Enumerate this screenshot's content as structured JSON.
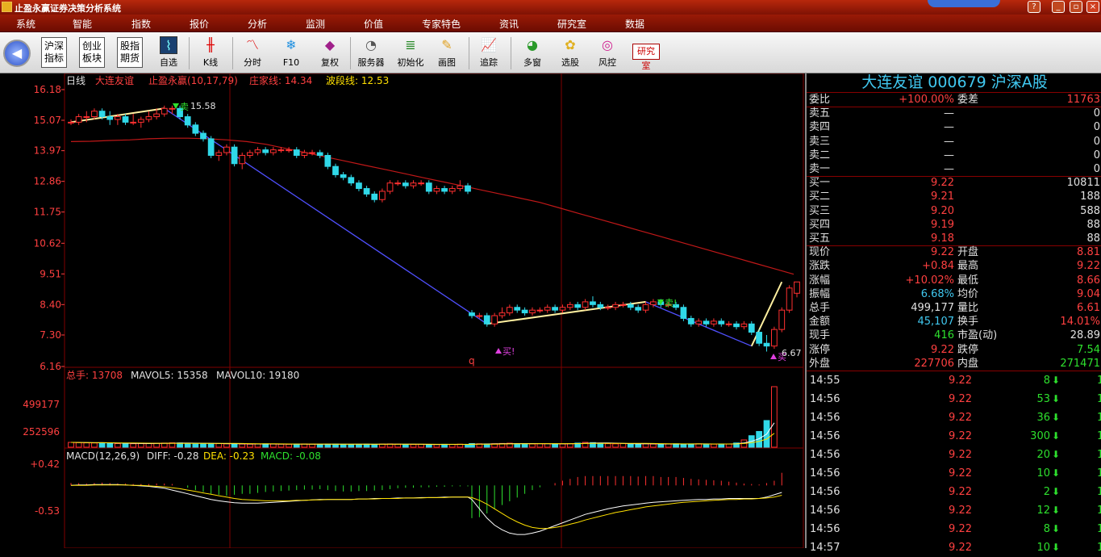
{
  "window": {
    "title": "止盈永赢证券决策分析系统"
  },
  "menu": [
    "系统",
    "智能",
    "指数",
    "报价",
    "分析",
    "监测",
    "价值",
    "专家特色",
    "资讯",
    "研究室",
    "数据"
  ],
  "toolbar": {
    "boxed": [
      "沪深\n指标",
      "创业\n板块",
      "股指\n期货"
    ],
    "buttons": [
      "自选",
      "K线",
      "分时",
      "F10",
      "复权",
      "服务器",
      "初始化",
      "画图",
      "追踪",
      "多窗",
      "选股",
      "风控"
    ],
    "research": "研究室"
  },
  "chart": {
    "period": "日线",
    "stock_name": "大连友谊",
    "indicator": "止盈永赢(10,17,79)",
    "zhuangjia_label": "庄家线: 14.34",
    "boduan_label": "波段线: 12.53",
    "price_ticks": [
      "16.18",
      "15.07",
      "13.97",
      "12.86",
      "11.75",
      "10.62",
      "9.51",
      "8.40",
      "7.30",
      "6.16"
    ],
    "markers": {
      "sell1": "卖",
      "sell1_val": "15.58",
      "buy1": "买!",
      "sell2": "卖!",
      "buy2": "买",
      "buy2_val": "6.67",
      "q": "q"
    },
    "volume": {
      "label": "总手: 13708",
      "ma5": "MAVOL5: 15358",
      "ma10": "MAVOL10: 19180",
      "ticks": [
        "499177",
        "252596"
      ]
    },
    "macd": {
      "label": "MACD(12,26,9)",
      "diff": "DIFF: -0.28",
      "dea": "DEA: -0.23",
      "macd": "MACD: -0.08",
      "ticks": [
        "+0.42",
        "-0.53"
      ]
    }
  },
  "chart_data": {
    "type": "candlestick",
    "price_range": [
      6.16,
      16.18
    ],
    "volume_range": [
      0,
      499177
    ],
    "macd_range": [
      -0.53,
      0.42
    ],
    "candles": [
      [
        15.0,
        15.1,
        14.9,
        15.0
      ],
      [
        15.0,
        15.3,
        14.9,
        15.2
      ],
      [
        15.2,
        15.4,
        15.0,
        15.2
      ],
      [
        15.2,
        15.5,
        15.1,
        15.4
      ],
      [
        15.4,
        15.5,
        15.1,
        15.2
      ],
      [
        15.2,
        15.4,
        14.9,
        15.1
      ],
      [
        15.1,
        15.3,
        14.9,
        15.2
      ],
      [
        15.2,
        15.3,
        14.9,
        15.0
      ],
      [
        15.0,
        15.3,
        14.9,
        15.0
      ],
      [
        15.0,
        15.2,
        14.8,
        15.1
      ],
      [
        15.1,
        15.4,
        15.0,
        15.2
      ],
      [
        15.2,
        15.5,
        15.1,
        15.3
      ],
      [
        15.3,
        15.6,
        15.2,
        15.5
      ],
      [
        15.5,
        15.6,
        15.3,
        15.5
      ],
      [
        15.5,
        15.6,
        15.1,
        15.2
      ],
      [
        15.2,
        15.3,
        14.8,
        14.9
      ],
      [
        14.9,
        15.0,
        14.5,
        14.6
      ],
      [
        14.6,
        14.7,
        14.3,
        14.4
      ],
      [
        14.4,
        14.5,
        13.7,
        13.8
      ],
      [
        13.8,
        14.0,
        13.6,
        13.9
      ],
      [
        13.9,
        14.2,
        13.8,
        14.1
      ],
      [
        14.1,
        14.2,
        13.4,
        13.5
      ],
      [
        13.5,
        13.9,
        13.3,
        13.8
      ],
      [
        13.8,
        14.0,
        13.7,
        13.9
      ],
      [
        13.9,
        14.1,
        13.8,
        14.0
      ],
      [
        14.0,
        14.1,
        13.8,
        13.9
      ],
      [
        13.9,
        14.1,
        13.8,
        14.0
      ],
      [
        14.0,
        14.1,
        13.9,
        14.0
      ],
      [
        14.0,
        14.1,
        13.9,
        14.0
      ],
      [
        14.0,
        14.1,
        13.7,
        13.8
      ],
      [
        13.8,
        14.0,
        13.7,
        13.9
      ],
      [
        13.9,
        14.0,
        13.8,
        13.9
      ],
      [
        13.9,
        14.0,
        13.7,
        13.8
      ],
      [
        13.8,
        13.9,
        13.3,
        13.4
      ],
      [
        13.4,
        13.5,
        13.0,
        13.1
      ],
      [
        13.1,
        13.2,
        12.9,
        13.0
      ],
      [
        13.0,
        13.1,
        12.7,
        12.8
      ],
      [
        12.8,
        12.9,
        12.5,
        12.6
      ],
      [
        12.6,
        12.7,
        12.3,
        12.4
      ],
      [
        12.4,
        12.5,
        12.1,
        12.2
      ],
      [
        12.2,
        12.6,
        12.1,
        12.5
      ],
      [
        12.5,
        12.9,
        12.4,
        12.8
      ],
      [
        12.8,
        12.9,
        12.7,
        12.8
      ],
      [
        12.8,
        12.9,
        12.6,
        12.7
      ],
      [
        12.7,
        12.9,
        12.6,
        12.8
      ],
      [
        12.8,
        12.9,
        12.7,
        12.8
      ],
      [
        12.8,
        12.9,
        12.4,
        12.5
      ],
      [
        12.5,
        12.7,
        12.4,
        12.6
      ],
      [
        12.6,
        12.7,
        12.4,
        12.5
      ],
      [
        12.5,
        12.7,
        12.4,
        12.6
      ],
      [
        12.6,
        12.9,
        12.5,
        12.7
      ],
      [
        12.7,
        12.8,
        12.4,
        12.5
      ],
      [
        8.1,
        8.2,
        7.9,
        8.0
      ],
      [
        8.0,
        8.1,
        7.9,
        8.0
      ],
      [
        8.0,
        8.1,
        7.6,
        7.7
      ],
      [
        7.7,
        8.1,
        7.6,
        8.0
      ],
      [
        8.0,
        8.3,
        7.9,
        8.1
      ],
      [
        8.1,
        8.4,
        8.0,
        8.3
      ],
      [
        8.3,
        8.4,
        8.1,
        8.2
      ],
      [
        8.2,
        8.3,
        8.0,
        8.1
      ],
      [
        8.1,
        8.3,
        8.0,
        8.2
      ],
      [
        8.2,
        8.3,
        8.1,
        8.2
      ],
      [
        8.2,
        8.4,
        8.1,
        8.3
      ],
      [
        8.3,
        8.4,
        8.1,
        8.2
      ],
      [
        8.2,
        8.4,
        8.1,
        8.3
      ],
      [
        8.3,
        8.5,
        8.2,
        8.4
      ],
      [
        8.4,
        8.5,
        8.2,
        8.3
      ],
      [
        8.3,
        8.6,
        8.2,
        8.5
      ],
      [
        8.5,
        8.7,
        8.3,
        8.4
      ],
      [
        8.4,
        8.5,
        8.2,
        8.3
      ],
      [
        8.3,
        8.4,
        8.2,
        8.3
      ],
      [
        8.3,
        8.5,
        8.2,
        8.4
      ],
      [
        8.4,
        8.5,
        8.3,
        8.4
      ],
      [
        8.4,
        8.5,
        8.2,
        8.3
      ],
      [
        8.3,
        8.4,
        8.1,
        8.2
      ],
      [
        8.2,
        8.5,
        8.1,
        8.4
      ],
      [
        8.4,
        8.6,
        8.3,
        8.5
      ],
      [
        8.5,
        8.6,
        8.3,
        8.4
      ],
      [
        8.4,
        8.5,
        8.3,
        8.4
      ],
      [
        8.4,
        8.5,
        8.2,
        8.3
      ],
      [
        8.3,
        8.4,
        7.8,
        7.9
      ],
      [
        7.9,
        8.0,
        7.6,
        7.7
      ],
      [
        7.7,
        7.9,
        7.6,
        7.8
      ],
      [
        7.8,
        7.9,
        7.6,
        7.7
      ],
      [
        7.7,
        7.9,
        7.6,
        7.8
      ],
      [
        7.8,
        7.9,
        7.6,
        7.7
      ],
      [
        7.7,
        7.8,
        7.6,
        7.7
      ],
      [
        7.7,
        7.8,
        7.5,
        7.6
      ],
      [
        7.6,
        7.8,
        7.5,
        7.7
      ],
      [
        7.7,
        7.8,
        7.3,
        7.4
      ],
      [
        7.4,
        7.5,
        6.9,
        7.0
      ],
      [
        7.0,
        7.3,
        6.7,
        6.9
      ],
      [
        6.9,
        7.6,
        6.8,
        7.5
      ],
      [
        7.5,
        8.3,
        7.4,
        8.2
      ],
      [
        8.2,
        9.1,
        8.1,
        9.0
      ],
      [
        8.81,
        9.22,
        8.66,
        9.22
      ]
    ],
    "gap_after_index": 51,
    "ma_line": [
      14.3,
      14.31,
      14.34,
      14.36,
      14.4,
      14.42,
      14.42,
      14.4,
      14.36,
      14.3,
      14.2,
      14.05,
      13.9,
      13.75,
      13.6,
      13.45,
      13.3,
      13.15,
      13.0,
      12.85,
      12.7,
      12.55,
      12.4,
      12.25,
      12.1,
      11.9,
      11.7,
      11.5,
      11.3,
      11.1,
      10.9,
      10.7,
      10.5,
      10.3,
      10.1,
      9.9,
      9.7,
      9.5
    ],
    "boduan_up": [
      [
        0,
        15.0
      ],
      [
        12,
        15.5
      ]
    ],
    "boduan_down": [
      [
        12,
        15.5
      ],
      [
        54,
        7.7
      ],
      [
        75,
        8.5
      ],
      [
        89,
        6.9
      ],
      [
        93,
        9.22
      ]
    ],
    "volumes": [
      40000,
      38000,
      36000,
      35000,
      37000,
      33000,
      30000,
      31000,
      29000,
      30000,
      31000,
      33000,
      34000,
      36000,
      35000,
      32000,
      30000,
      29000,
      31000,
      30000,
      28000,
      27000,
      26000,
      25000,
      27000,
      28000,
      26000,
      25000,
      24000,
      26000,
      27000,
      25000,
      24000,
      25000,
      26000,
      24000,
      23000,
      24000,
      25000,
      24000,
      26000,
      27000,
      25000,
      23000,
      22000,
      24000,
      23000,
      22000,
      24000,
      23000,
      25000,
      24000,
      30000,
      28000,
      27000,
      29000,
      31000,
      33000,
      30000,
      28000,
      27000,
      29000,
      30000,
      28000,
      27000,
      30000,
      34000,
      40000,
      38000,
      32000,
      29000,
      28000,
      30000,
      29000,
      27000,
      28000,
      26000,
      25000,
      27000,
      28000,
      26000,
      27000,
      28000,
      26000,
      25000,
      27000,
      26000,
      35000,
      60000,
      95000,
      130000,
      220000,
      499177
    ],
    "macd_hist": [
      0.05,
      0.05,
      0.04,
      0.05,
      0.06,
      0.05,
      0.04,
      0.04,
      0.03,
      0.03,
      0.03,
      0.04,
      0.04,
      0.03,
      0.0,
      -0.05,
      -0.1,
      -0.14,
      -0.18,
      -0.2,
      -0.22,
      -0.2,
      -0.18,
      -0.18,
      -0.16,
      -0.14,
      -0.13,
      -0.12,
      -0.11,
      -0.1,
      -0.09,
      -0.09,
      -0.08,
      -0.1,
      -0.12,
      -0.13,
      -0.13,
      -0.12,
      -0.12,
      -0.11,
      -0.1,
      -0.08,
      -0.06,
      -0.05,
      -0.05,
      -0.04,
      -0.04,
      -0.03,
      -0.03,
      -0.02,
      -0.02,
      -0.02,
      -0.7,
      -0.68,
      -0.6,
      -0.5,
      -0.42,
      -0.34,
      -0.26,
      -0.18,
      -0.1,
      -0.04,
      0.0,
      0.05,
      0.1,
      0.14,
      0.18,
      0.2,
      0.2,
      0.2,
      0.2,
      0.2,
      0.2,
      0.2,
      0.19,
      0.2,
      0.2,
      0.18,
      0.18,
      0.18,
      0.16,
      0.14,
      0.13,
      0.12,
      0.11,
      0.1,
      0.08,
      0.06,
      0.04,
      0.03,
      0.02,
      0.05,
      0.1,
      0.27
    ],
    "diff": [
      0.0,
      0.01,
      0.01,
      0.02,
      0.02,
      0.02,
      0.02,
      0.01,
      0.0,
      -0.01,
      -0.02,
      -0.04,
      -0.06,
      -0.1,
      -0.14,
      -0.18,
      -0.22,
      -0.26,
      -0.3,
      -0.33,
      -0.35,
      -0.37,
      -0.38,
      -0.38,
      -0.38,
      -0.37,
      -0.36,
      -0.35,
      -0.34,
      -0.33,
      -0.32,
      -0.31,
      -0.3,
      -0.3,
      -0.3,
      -0.3,
      -0.3,
      -0.29,
      -0.29,
      -0.28,
      -0.28,
      -0.28,
      -0.27,
      -0.27,
      -0.27,
      -0.26,
      -0.26,
      -0.26,
      -0.25,
      -0.25,
      -0.25,
      -0.25,
      -0.3,
      -0.5,
      -0.7,
      -0.85,
      -0.95,
      -1.02,
      -1.05,
      -1.05,
      -1.02,
      -0.98,
      -0.92,
      -0.86,
      -0.8,
      -0.74,
      -0.68,
      -0.62,
      -0.58,
      -0.54,
      -0.5,
      -0.47,
      -0.44,
      -0.42,
      -0.4,
      -0.38,
      -0.36,
      -0.35,
      -0.34,
      -0.33,
      -0.32,
      -0.31,
      -0.3,
      -0.3,
      -0.29,
      -0.29,
      -0.28,
      -0.28,
      -0.28,
      -0.28,
      -0.28,
      -0.25,
      -0.2,
      -0.15
    ],
    "dea": [
      0.0,
      0.0,
      0.0,
      0.01,
      0.01,
      0.01,
      0.01,
      0.01,
      0.0,
      0.0,
      -0.01,
      -0.02,
      -0.03,
      -0.05,
      -0.07,
      -0.1,
      -0.13,
      -0.16,
      -0.19,
      -0.22,
      -0.25,
      -0.28,
      -0.3,
      -0.31,
      -0.32,
      -0.33,
      -0.33,
      -0.33,
      -0.33,
      -0.32,
      -0.32,
      -0.31,
      -0.31,
      -0.3,
      -0.3,
      -0.3,
      -0.3,
      -0.29,
      -0.29,
      -0.29,
      -0.28,
      -0.28,
      -0.28,
      -0.27,
      -0.27,
      -0.27,
      -0.26,
      -0.26,
      -0.26,
      -0.25,
      -0.25,
      -0.25,
      -0.26,
      -0.32,
      -0.4,
      -0.5,
      -0.6,
      -0.7,
      -0.78,
      -0.85,
      -0.9,
      -0.92,
      -0.92,
      -0.9,
      -0.87,
      -0.83,
      -0.79,
      -0.74,
      -0.7,
      -0.66,
      -0.62,
      -0.58,
      -0.55,
      -0.52,
      -0.49,
      -0.46,
      -0.44,
      -0.42,
      -0.4,
      -0.38,
      -0.36,
      -0.35,
      -0.34,
      -0.33,
      -0.32,
      -0.31,
      -0.3,
      -0.3,
      -0.29,
      -0.29,
      -0.28,
      -0.27,
      -0.25,
      -0.21
    ]
  },
  "quote": {
    "title": "大连友谊  000679  沪深A股",
    "weibi": {
      "label": "委比",
      "value": "+100.00%",
      "label2": "委差",
      "value2": "11763"
    },
    "sells": [
      {
        "label": "卖五",
        "p": "—",
        "v": "0"
      },
      {
        "label": "卖四",
        "p": "—",
        "v": "0"
      },
      {
        "label": "卖三",
        "p": "—",
        "v": "0"
      },
      {
        "label": "卖二",
        "p": "—",
        "v": "0"
      },
      {
        "label": "卖一",
        "p": "—",
        "v": "0"
      }
    ],
    "buys": [
      {
        "label": "买一",
        "p": "9.22",
        "v": "10811"
      },
      {
        "label": "买二",
        "p": "9.21",
        "v": "188"
      },
      {
        "label": "买三",
        "p": "9.20",
        "v": "588"
      },
      {
        "label": "买四",
        "p": "9.19",
        "v": "88"
      },
      {
        "label": "买五",
        "p": "9.18",
        "v": "88"
      }
    ],
    "stats": [
      {
        "l1": "现价",
        "v1": "9.22",
        "c1": "#ff4040",
        "l2": "开盘",
        "v2": "8.81",
        "c2": "#ff4040"
      },
      {
        "l1": "涨跌",
        "v1": "+0.84",
        "c1": "#ff4040",
        "l2": "最高",
        "v2": "9.22",
        "c2": "#ff4040"
      },
      {
        "l1": "涨幅",
        "v1": "+10.02%",
        "c1": "#ff4040",
        "l2": "最低",
        "v2": "8.66",
        "c2": "#ff4040"
      },
      {
        "l1": "振幅",
        "v1": "6.68%",
        "c1": "#40c8f0",
        "l2": "均价",
        "v2": "9.04",
        "c2": "#ff4040"
      },
      {
        "l1": "总手",
        "v1": "499,177",
        "c1": "#e0e0e0",
        "l2": "量比",
        "v2": "6.61",
        "c2": "#ff4040"
      },
      {
        "l1": "金额",
        "v1": "45,107",
        "c1": "#40c8f0",
        "l2": "换手",
        "v2": "14.01%",
        "c2": "#ff4040"
      },
      {
        "l1": "现手",
        "v1": "416",
        "c1": "#2ee02e",
        "l2": "市盈(动)",
        "v2": "28.89",
        "c2": "#e0e0e0"
      },
      {
        "l1": "涨停",
        "v1": "9.22",
        "c1": "#ff4040",
        "l2": "跌停",
        "v2": "7.54",
        "c2": "#2ee02e"
      },
      {
        "l1": "外盘",
        "v1": "227706",
        "c1": "#ff4040",
        "l2": "内盘",
        "v2": "271471",
        "c2": "#2ee02e"
      }
    ],
    "ticks": [
      {
        "t": "14:55",
        "p": "9.22",
        "v": "8",
        "arrow": "⬇",
        "x": "1"
      },
      {
        "t": "14:56",
        "p": "9.22",
        "v": "53",
        "arrow": "⬇",
        "x": "1"
      },
      {
        "t": "14:56",
        "p": "9.22",
        "v": "36",
        "arrow": "⬇",
        "x": "1"
      },
      {
        "t": "14:56",
        "p": "9.22",
        "v": "300",
        "arrow": "⬇",
        "x": "1"
      },
      {
        "t": "14:56",
        "p": "9.22",
        "v": "20",
        "arrow": "⬇",
        "x": "1"
      },
      {
        "t": "14:56",
        "p": "9.22",
        "v": "10",
        "arrow": "⬇",
        "x": "1"
      },
      {
        "t": "14:56",
        "p": "9.22",
        "v": "2",
        "arrow": "⬇",
        "x": "1"
      },
      {
        "t": "14:56",
        "p": "9.22",
        "v": "12",
        "arrow": "⬇",
        "x": "1"
      },
      {
        "t": "14:56",
        "p": "9.22",
        "v": "8",
        "arrow": "⬇",
        "x": "1"
      },
      {
        "t": "14:57",
        "p": "9.22",
        "v": "10",
        "arrow": "⬇",
        "x": "1"
      }
    ]
  },
  "colors": {
    "up": "#ff3030",
    "down": "#30d8e8",
    "ma": "#c01818",
    "wave_up": "#fff0a0",
    "wave_down": "#5050ff",
    "grid": "#800000"
  }
}
